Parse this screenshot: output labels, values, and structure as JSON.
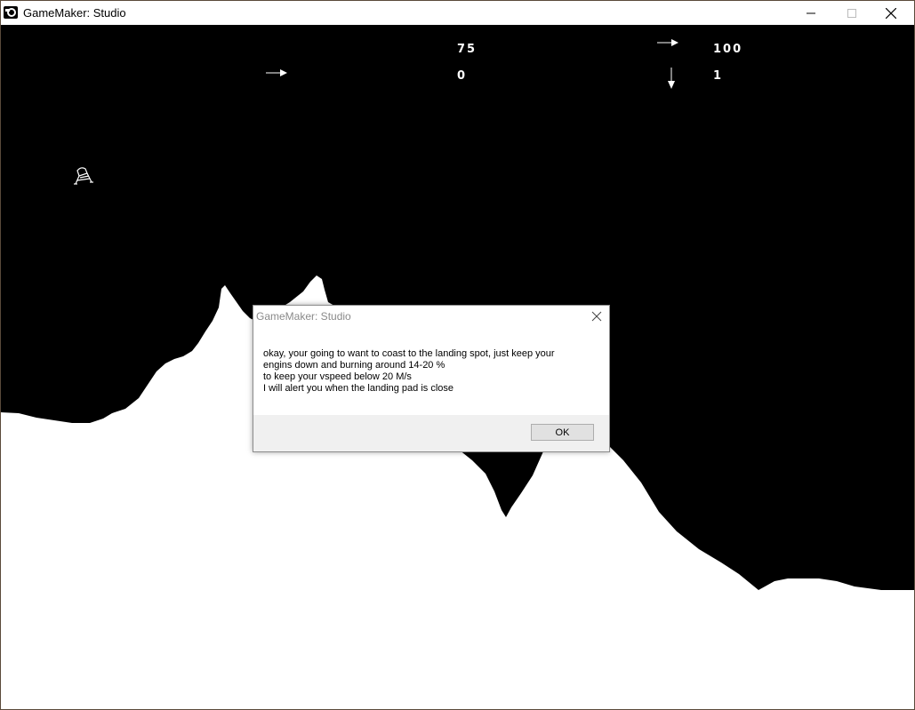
{
  "window": {
    "title": "GameMaker: Studio"
  },
  "hud": {
    "top_center_value": "75",
    "bottom_center_value": "0",
    "top_right_value": "100",
    "bottom_right_value": "1"
  },
  "icons": {
    "app": "gamemaker-logo-icon",
    "minimize": "minimize-icon",
    "maximize": "maximize-icon",
    "close": "close-icon",
    "hud_arrows": [
      "arrow-right-icon",
      "arrow-right-icon",
      "arrow-down-icon"
    ],
    "player": "lunar-lander-sprite"
  },
  "dialog": {
    "title": "GameMaker: Studio",
    "message_lines": [
      "okay, your going to want to coast to the landing spot, just keep your",
      "engins down and burning around 14-20 %",
      "to keep your vspeed below 20 M/s",
      "I will alert you when the landing pad is close"
    ],
    "ok_label": "OK"
  },
  "colors": {
    "sky": "#000000",
    "terrain": "#ffffff",
    "hud_text": "#ffffff"
  }
}
